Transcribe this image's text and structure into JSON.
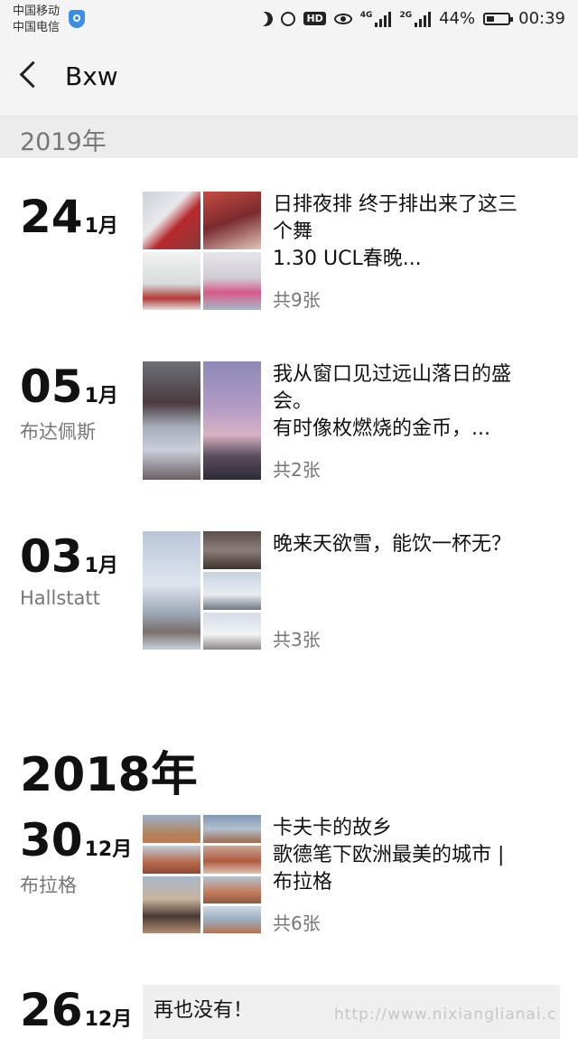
{
  "status_bar": {
    "carrier_1": "中国移动",
    "carrier_2": "中国电信",
    "network_label_1": "4G",
    "network_label_2": "2G",
    "hd_label": "HD",
    "battery": "44%",
    "time": "00:39"
  },
  "header": {
    "title": "Bxw"
  },
  "sections": [
    {
      "year": "2019年"
    },
    {
      "year": "2018年"
    }
  ],
  "entries": [
    {
      "day": "24",
      "month": "1月",
      "location": "",
      "lines": [
        "日排夜排 终于排出来了这三",
        "个舞",
        "1.30  UCL春晚..."
      ],
      "count": "共9张"
    },
    {
      "day": "05",
      "month": "1月",
      "location": "布达佩斯",
      "lines": [
        "我从窗口见过远山落日的盛",
        "会。",
        "有时像枚燃烧的金币，..."
      ],
      "count": "共2张"
    },
    {
      "day": "03",
      "month": "1月",
      "location": "Hallstatt",
      "lines": [
        "晚来天欲雪，能饮一杯无？"
      ],
      "count": "共3张"
    },
    {
      "day": "30",
      "month": "12月",
      "location": "布拉格",
      "lines": [
        "卡夫卡的故乡",
        "歌德笔下欧洲最美的城市 |",
        "布拉格"
      ],
      "count": "共6张"
    },
    {
      "day": "26",
      "month": "12月",
      "location": "",
      "text_card": "再也没有！"
    }
  ],
  "watermark": "http://www.nixianglianai.c",
  "colors": {
    "header_bg": "#f4f4f4",
    "year_band_bg": "#ececec",
    "muted_text": "#777777"
  }
}
